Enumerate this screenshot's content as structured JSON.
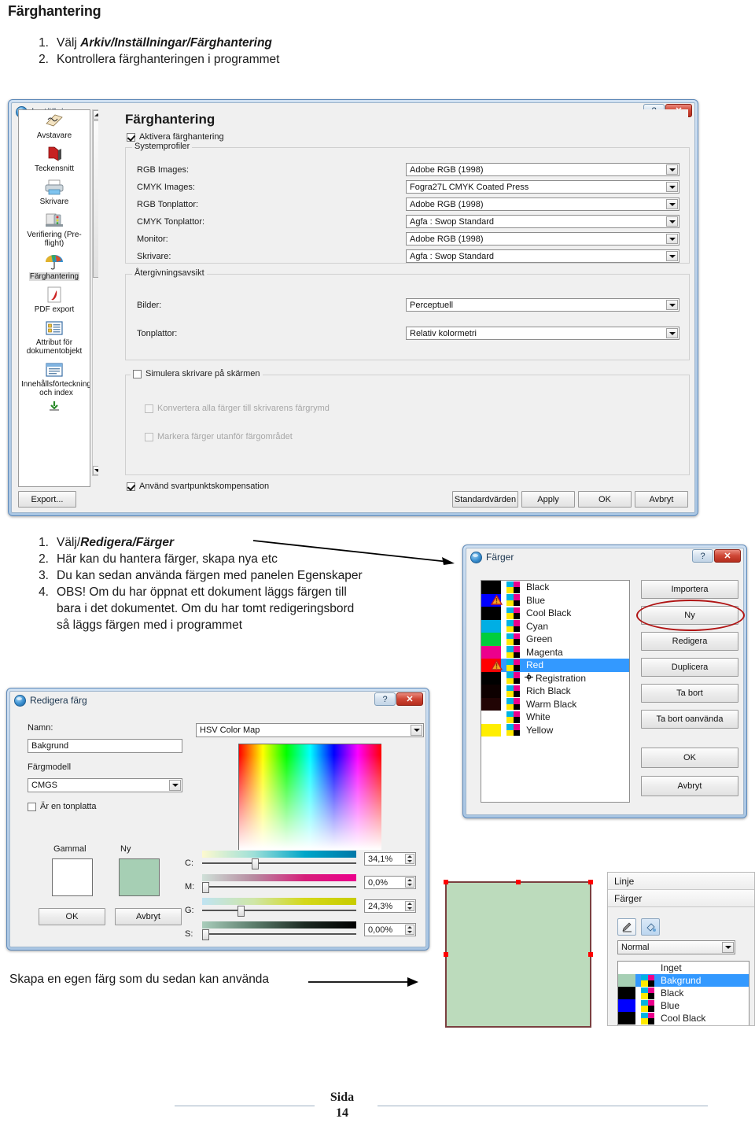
{
  "document": {
    "title": "Färghantering",
    "steps_top": [
      {
        "num": "1.",
        "plain": "Välj ",
        "emph": "Arkiv/Inställningar/Färghantering"
      },
      {
        "num": "2.",
        "plain": "Kontrollera färghanteringen i programmet",
        "emph": ""
      }
    ],
    "steps_mid": [
      {
        "num": "1.",
        "plain": "Välj/",
        "emph": "Redigera/Färger"
      },
      {
        "num": "2.",
        "plain": "Här kan du hantera färger, skapa nya etc",
        "emph": ""
      },
      {
        "num": "3.",
        "plain": "Du kan sedan använda färgen med panelen Egenskaper",
        "emph": ""
      },
      {
        "num": "4.",
        "plain": "OBS! Om du har öppnat ett dokument läggs färgen till",
        "emph": ""
      },
      {
        "num": "",
        "plain": "bara i det dokumentet. Om du har tomt redigeringsbord",
        "emph": ""
      },
      {
        "num": "",
        "plain": "så läggs färgen med i programmet",
        "emph": ""
      }
    ],
    "caption_bottom": "Skapa en egen färg som du sedan kan använda",
    "footer": {
      "label": "Sida",
      "page": "14"
    }
  },
  "settings_dialog": {
    "title": "Inställningar",
    "help_button": "?",
    "close_button": "✕",
    "sidebar": [
      {
        "label": "Avstavare",
        "icon": "hyphenation-icon",
        "selected": false
      },
      {
        "label": "Teckensnitt",
        "icon": "fonts-icon",
        "selected": false
      },
      {
        "label": "Skrivare",
        "icon": "printer-icon",
        "selected": false
      },
      {
        "label": "Verifiering (Pre-flight)",
        "icon": "preflight-icon",
        "selected": false
      },
      {
        "label": "Färghantering",
        "icon": "umbrella-icon",
        "selected": true
      },
      {
        "label": "PDF export",
        "icon": "pdf-icon",
        "selected": false
      },
      {
        "label": "Attribut för dokumentobjekt",
        "icon": "attributes-icon",
        "selected": false
      },
      {
        "label": "Innehållsförteckning och index",
        "icon": "toc-icon",
        "selected": false
      }
    ],
    "pane_heading": "Färghantering",
    "enable_checkbox": {
      "label": "Aktivera färghantering",
      "checked": true
    },
    "group_systemprofiles": {
      "legend": "Systemprofiler",
      "rows": [
        {
          "label": "RGB Images:",
          "value": "Adobe RGB (1998)"
        },
        {
          "label": "CMYK Images:",
          "value": "Fogra27L CMYK Coated Press"
        },
        {
          "label": "RGB Tonplattor:",
          "value": "Adobe RGB (1998)"
        },
        {
          "label": "CMYK Tonplattor:",
          "value": "Agfa : Swop Standard"
        },
        {
          "label": "Monitor:",
          "value": "Adobe RGB (1998)"
        },
        {
          "label": "Skrivare:",
          "value": "Agfa : Swop Standard"
        }
      ]
    },
    "group_rendering": {
      "legend": "Återgivningsavsikt",
      "rows": [
        {
          "label": "Bilder:",
          "value": "Perceptuell"
        },
        {
          "label": "Tonplattor:",
          "value": "Relativ kolormetri"
        }
      ]
    },
    "group_simulate": {
      "legend": "Simulera skrivare på skärmen",
      "checked": false,
      "options": [
        {
          "label": "Konvertera alla färger till skrivarens färgrymd",
          "checked": false,
          "disabled": true
        },
        {
          "label": "Markera färger utanför färgområdet",
          "checked": false,
          "disabled": true
        }
      ]
    },
    "blackpoint_checkbox": {
      "label": "Använd svartpunktskompensation",
      "checked": true
    },
    "export_button": "Export...",
    "buttons": [
      "Standardvärden",
      "Apply",
      "OK",
      "Avbryt"
    ]
  },
  "colors_dialog": {
    "title": "Färger",
    "help_button": "?",
    "close_button": "✕",
    "list": [
      {
        "name": "Black",
        "swatch": "#000000",
        "selected": false,
        "warning": false,
        "registration": false
      },
      {
        "name": "Blue",
        "swatch": "#0000ff",
        "selected": false,
        "warning": true,
        "registration": false
      },
      {
        "name": "Cool Black",
        "swatch": "#000000",
        "selected": false,
        "warning": false,
        "registration": false
      },
      {
        "name": "Cyan",
        "swatch": "#00aee4",
        "selected": false,
        "warning": false,
        "registration": false
      },
      {
        "name": "Green",
        "swatch": "#00ce3c",
        "selected": false,
        "warning": false,
        "registration": false
      },
      {
        "name": "Magenta",
        "swatch": "#ec008c",
        "selected": false,
        "warning": false,
        "registration": false
      },
      {
        "name": "Red",
        "swatch": "#ff0000",
        "selected": true,
        "warning": true,
        "registration": false
      },
      {
        "name": "Registration",
        "swatch": "#000000",
        "selected": false,
        "warning": false,
        "registration": true
      },
      {
        "name": "Rich Black",
        "swatch": "#0d0000",
        "selected": false,
        "warning": false,
        "registration": false
      },
      {
        "name": "Warm Black",
        "swatch": "#210404",
        "selected": false,
        "warning": false,
        "registration": false
      },
      {
        "name": "White",
        "swatch": "#ffffff",
        "selected": false,
        "warning": false,
        "registration": false
      },
      {
        "name": "Yellow",
        "swatch": "#ffee00",
        "selected": false,
        "warning": false,
        "registration": false
      }
    ],
    "buttons_top": [
      "Importera",
      "Ny",
      "Redigera",
      "Duplicera",
      "Ta bort",
      "Ta bort oanvända"
    ],
    "buttons_bottom": [
      "OK",
      "Avbryt"
    ],
    "highlight_ring_target": "Ny",
    "highlight_ring_color": "#b01414"
  },
  "editcolor_dialog": {
    "title": "Redigera färg",
    "help_button": "?",
    "close_button": "✕",
    "name_label": "Namn:",
    "name_value": "Bakgrund",
    "model_label": "Färgmodell",
    "model_value": "CMGS",
    "tint_checkbox": {
      "label": "Är en tonplatta",
      "checked": false
    },
    "map_select": "HSV Color Map",
    "old_label": "Gammal",
    "new_label": "Ny",
    "old_color": "#ffffff",
    "new_color": "#a6cfb4",
    "buttons": [
      "OK",
      "Avbryt"
    ],
    "sliders": [
      {
        "label": "C:",
        "value": "34,1%",
        "pos": 34.1
      },
      {
        "label": "M:",
        "value": "0,0%",
        "pos": 0.0
      },
      {
        "label": "G:",
        "value": "24,3%",
        "pos": 24.3
      },
      {
        "label": "S:",
        "value": "0,00%",
        "pos": 0.0
      }
    ]
  },
  "properties_panel": {
    "section_line": "Linje",
    "section_colors": "Färger",
    "tool_pen": "pen-tool-icon",
    "tool_fill": "fill-tool-icon",
    "blend_mode": "Normal",
    "swatches": [
      {
        "name": "Inget",
        "swatch": "none",
        "selected": false
      },
      {
        "name": "Bakgrund",
        "swatch": "#a6cfb4",
        "selected": true
      },
      {
        "name": "Black",
        "swatch": "#000000",
        "selected": false
      },
      {
        "name": "Blue",
        "swatch": "#0000ff",
        "selected": false
      },
      {
        "name": "Cool Black",
        "swatch": "#000000",
        "selected": false
      }
    ]
  },
  "artboard": {
    "rect_fill": "#bcdbbc",
    "rect_stroke": "#7a4040",
    "handle_color": "#ff0000"
  }
}
